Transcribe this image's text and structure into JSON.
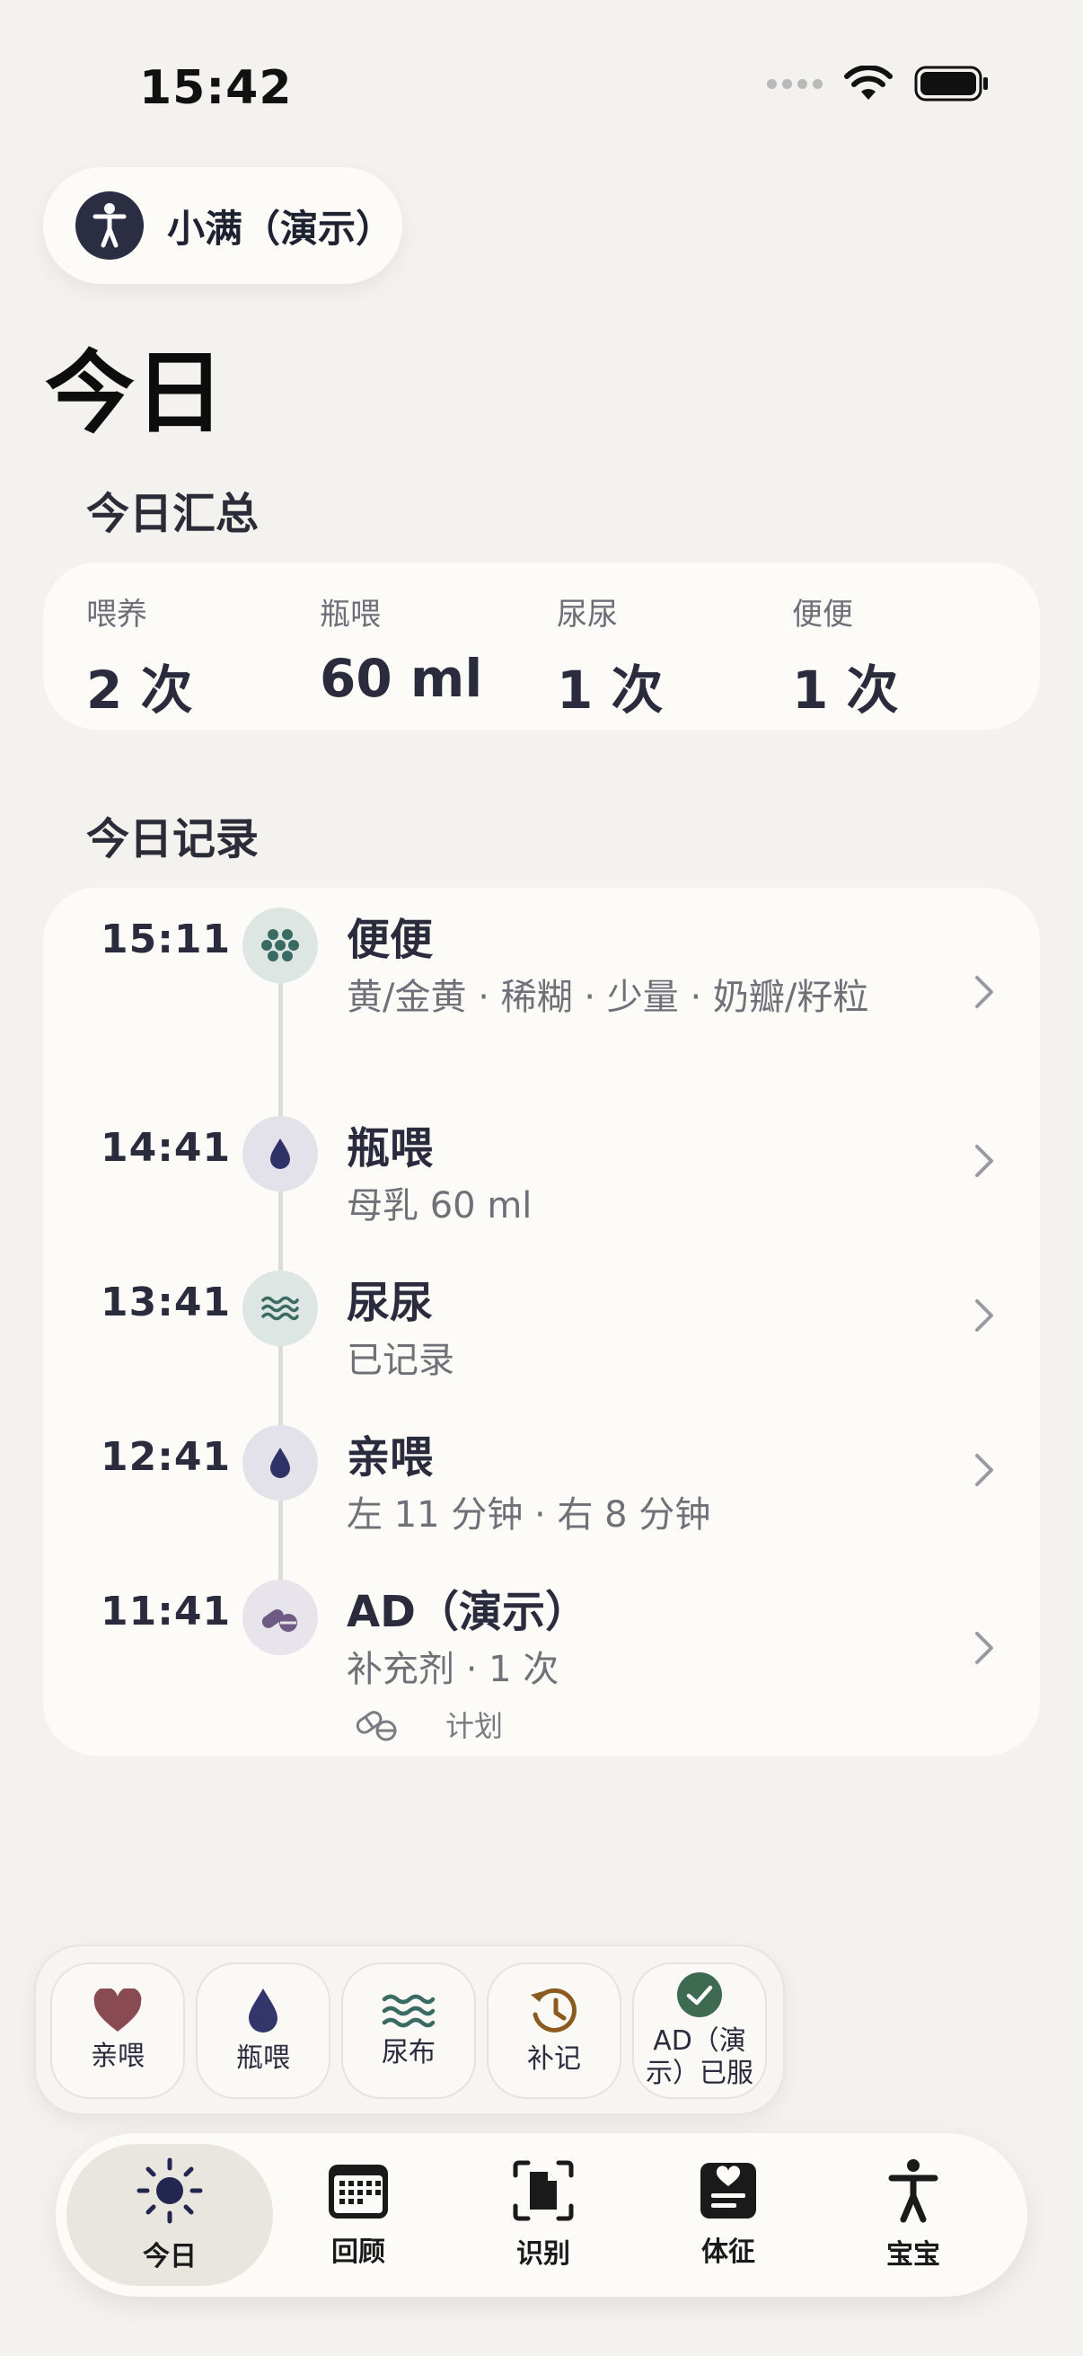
{
  "status_bar": {
    "time": "15:42"
  },
  "baby": {
    "name": "小满（演示）"
  },
  "page": {
    "title": "今日"
  },
  "summary": {
    "title": "今日汇总",
    "items": [
      {
        "label": "喂养",
        "value": "2 次"
      },
      {
        "label": "瓶喂",
        "value": "60 ml"
      },
      {
        "label": "尿尿",
        "value": "1 次"
      },
      {
        "label": "便便",
        "value": "1 次"
      }
    ]
  },
  "records": {
    "title": "今日记录",
    "items": [
      {
        "time": "15:11",
        "title": "便便",
        "subtitle": "黄/金黄 · 稀糊 · 少量 · 奶瓣/籽粒",
        "icon": "poop-dots-icon"
      },
      {
        "time": "14:41",
        "title": "瓶喂",
        "subtitle": "母乳 60 ml",
        "icon": "drop-icon"
      },
      {
        "time": "13:41",
        "title": "尿尿",
        "subtitle": "已记录",
        "icon": "waves-icon"
      },
      {
        "time": "12:41",
        "title": "亲喂",
        "subtitle": "左 11 分钟 · 右 8 分钟",
        "icon": "drop-icon"
      },
      {
        "time": "11:41",
        "title": "AD（演示）",
        "subtitle": "补充剂 · 1 次",
        "icon": "pills-icon",
        "extra_label": "计划"
      }
    ]
  },
  "quick_actions": [
    {
      "label": "亲喂",
      "icon": "heart-icon",
      "color": "#8a4a52"
    },
    {
      "label": "瓶喂",
      "icon": "drop-icon",
      "color": "#33366b"
    },
    {
      "label": "尿布",
      "icon": "waves-icon",
      "color": "#3a6b62"
    },
    {
      "label": "补记",
      "icon": "history-icon",
      "color": "#8a5a1e"
    },
    {
      "label": "AD（演示）已服",
      "icon": "check-circle-icon",
      "color": "#3e6a52"
    }
  ],
  "tabs": [
    {
      "label": "今日",
      "icon": "sun-icon",
      "active": true
    },
    {
      "label": "回顾",
      "icon": "calendar-icon"
    },
    {
      "label": "识别",
      "icon": "scan-document-icon"
    },
    {
      "label": "体征",
      "icon": "vitals-icon"
    },
    {
      "label": "宝宝",
      "icon": "person-icon"
    }
  ],
  "colors": {
    "background": "#f4f2ee",
    "card": "#fcfbf8",
    "accent_navy": "#2b2d42",
    "teal_icon_bg": "#dde6e2",
    "lavender_icon_bg": "#e3e2ea"
  }
}
